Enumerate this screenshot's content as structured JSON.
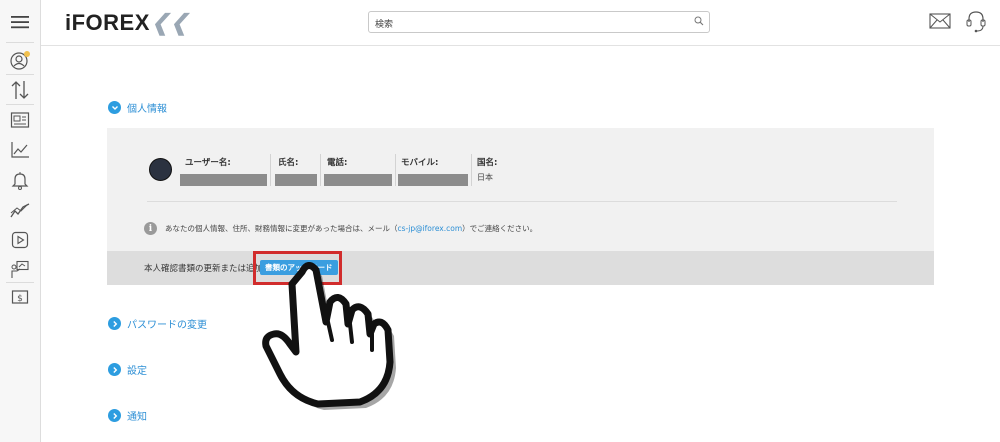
{
  "brand": {
    "logo_text": "iFOREX",
    "accent": "#2d9de0"
  },
  "search": {
    "value": "検索",
    "icon": "search-icon"
  },
  "sections": {
    "personal": "個人情報",
    "password": "パスワードの変更",
    "settings": "設定",
    "notifications": "通知"
  },
  "profile": {
    "username_label": "ユーザー名:",
    "name_label": "氏名:",
    "phone_label": "電話:",
    "mobile_label": "モバイル:",
    "country_label": "国名:",
    "country_value": "日本"
  },
  "info": {
    "text_before": "あなたの個人情報、住所、財務情報に変更があった場合は、メール（",
    "email": "cs-jp@iforex.com",
    "text_after": "）でご連絡ください。"
  },
  "upload": {
    "prompt": "本人確認書類の更新または追加:",
    "button_label": "書類のアップロード"
  }
}
